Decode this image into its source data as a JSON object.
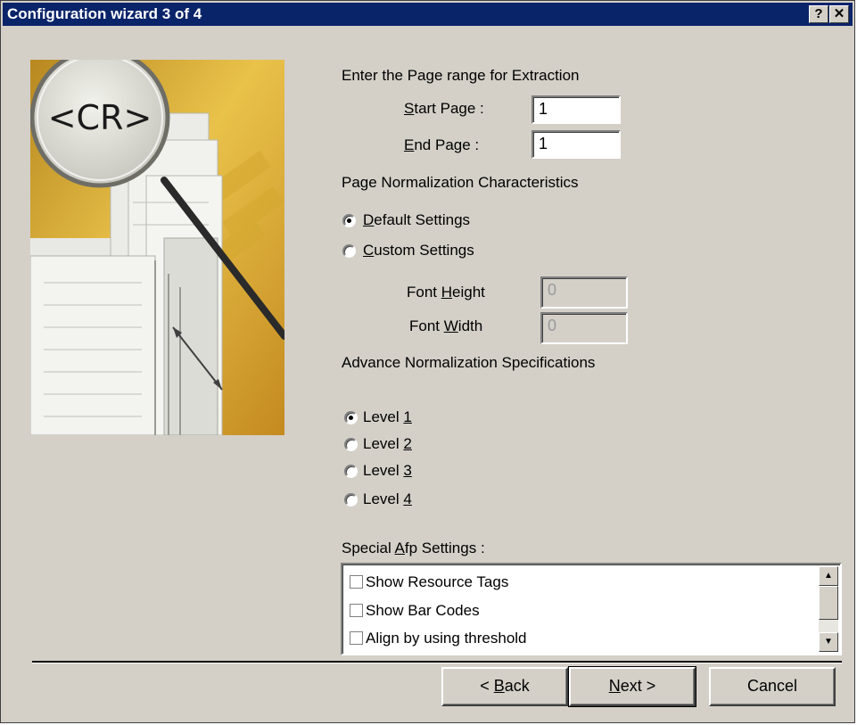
{
  "window": {
    "title": "Configuration wizard 3 of 4",
    "help_button": "?",
    "close_button": "✕"
  },
  "illustration": {
    "logo_text": "<CR>",
    "accent_color": "#e0b030"
  },
  "page_range": {
    "heading": "Enter the Page range for Extraction",
    "start": {
      "label_key": "S",
      "label_rest": "tart Page  :",
      "value": "1"
    },
    "end": {
      "label_key": "E",
      "label_rest": "nd Page   :",
      "value": "1"
    }
  },
  "normalization": {
    "heading": "Page Normalization Characteristics",
    "default": {
      "key": "D",
      "rest": "efault Settings",
      "selected": true
    },
    "custom": {
      "key": "C",
      "rest": "ustom Settings",
      "selected": false
    },
    "font_height": {
      "pre": "Font ",
      "key": "H",
      "post": "eight",
      "value": "0"
    },
    "font_width": {
      "pre": "Font ",
      "key": "W",
      "post": "idth",
      "value": "0"
    }
  },
  "advanced": {
    "heading": "Advance Normalization Specifications",
    "levels": [
      {
        "pre": "Level ",
        "key": "1",
        "selected": true
      },
      {
        "pre": "Level ",
        "key": "2",
        "selected": false
      },
      {
        "pre": "Level ",
        "key": "3",
        "selected": false
      },
      {
        "pre": "Level ",
        "key": "4",
        "selected": false
      }
    ]
  },
  "special_afp": {
    "heading_pre": "Special ",
    "heading_key": "A",
    "heading_post": "fp Settings :",
    "items": [
      {
        "label": "Show Resource Tags",
        "checked": false
      },
      {
        "label": "Show Bar Codes",
        "checked": false
      },
      {
        "label": "Align by using threshold",
        "checked": false
      }
    ]
  },
  "buttons": {
    "back": {
      "pre": "< ",
      "key": "B",
      "post": "ack"
    },
    "next": {
      "key": "N",
      "post": "ext >"
    },
    "cancel": "Cancel"
  }
}
